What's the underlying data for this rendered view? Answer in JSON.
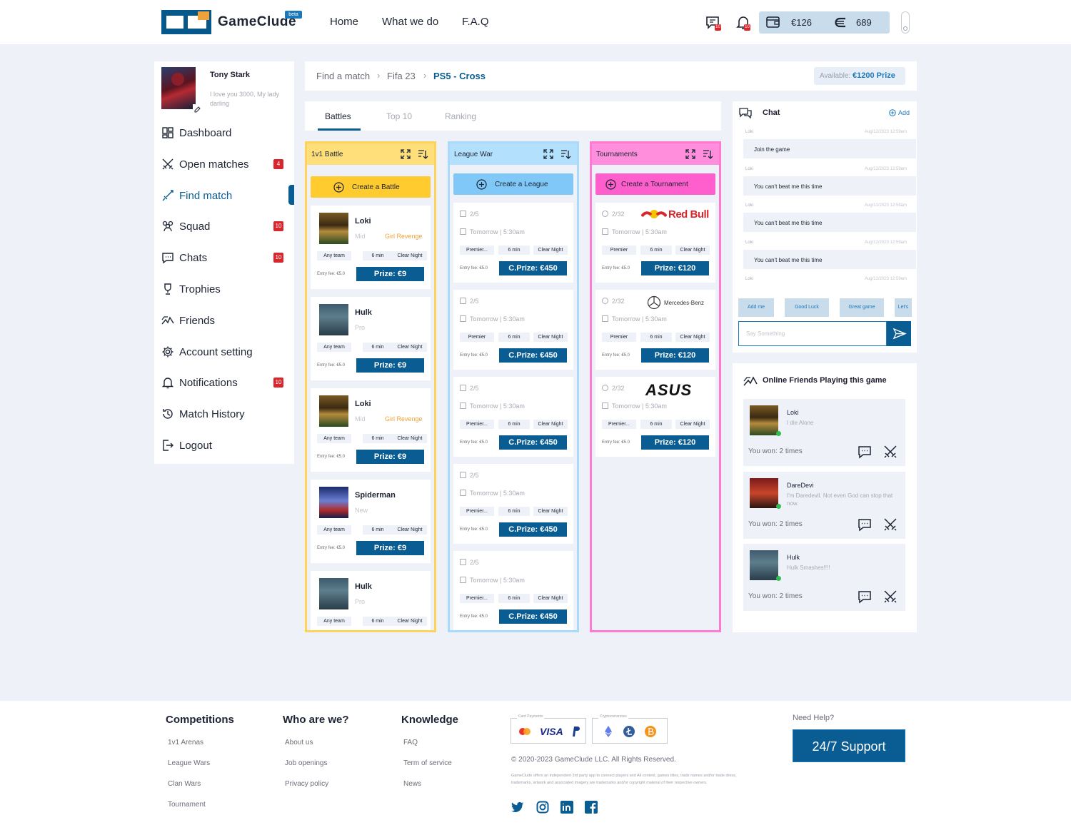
{
  "header": {
    "brand": "GameClude",
    "beta": "beta",
    "nav": [
      "Home",
      "What we do",
      "F.A.Q"
    ],
    "chat_badge": "10",
    "notif_badge": "10",
    "balance": "€126",
    "coins": "689"
  },
  "profile": {
    "name": "Tony Stark",
    "bio": "I love you 3000, My lady darling"
  },
  "sidebar": {
    "items": [
      {
        "label": "Dashboard",
        "icon": "dashboard-icon"
      },
      {
        "label": "Open matches",
        "icon": "swords-icon",
        "badge": "4"
      },
      {
        "label": "Find match",
        "icon": "sword-icon",
        "active": true
      },
      {
        "label": "Squad",
        "icon": "squad-icon",
        "badge": "10"
      },
      {
        "label": "Chats",
        "icon": "chat-icon",
        "badge": "10"
      },
      {
        "label": "Trophies",
        "icon": "trophy-icon"
      },
      {
        "label": "Friends",
        "icon": "friends-icon"
      },
      {
        "label": "Account setting",
        "icon": "gear-icon"
      },
      {
        "label": "Notifications",
        "icon": "bell-icon",
        "badge": "10"
      },
      {
        "label": "Match History",
        "icon": "history-icon"
      },
      {
        "label": "Logout",
        "icon": "logout-icon"
      }
    ]
  },
  "breadcrumb": {
    "items": [
      "Find a match",
      "Fifa 23",
      "PS5 - Cross"
    ],
    "available_label": "Available:",
    "available_value": "€1200 Prize"
  },
  "tabs": [
    "Battles",
    "Top 10",
    "Ranking"
  ],
  "columns": {
    "battle": {
      "title": "1v1 Battle",
      "button": "Create a Battle",
      "color": "#ffdf7a",
      "border": "#ffd25c",
      "btn": "#ffcb2f",
      "cards": [
        {
          "name": "Loki",
          "rank": "Mid",
          "badge": "Girl Revenge",
          "chips": [
            "Any team",
            "6 min",
            "Clear Night"
          ],
          "entry": "Entry fee: €5.0",
          "prize": "Prize: €9"
        },
        {
          "name": "Hulk",
          "rank": "Pro",
          "badge": "",
          "chips": [
            "Any team",
            "6 min",
            "Clear Night"
          ],
          "entry": "Entry fee: €5.0",
          "prize": "Prize: €9"
        },
        {
          "name": "Loki",
          "rank": "Mid",
          "badge": "Girl Revenge",
          "chips": [
            "Any team",
            "6 min",
            "Clear Night"
          ],
          "entry": "Entry fee: €5.0",
          "prize": "Prize: €9"
        },
        {
          "name": "Spiderman",
          "rank": "New",
          "badge": "",
          "chips": [
            "Any team",
            "6 min",
            "Clear Night"
          ],
          "entry": "Entry fee: €5.0",
          "prize": "Prize: €9"
        },
        {
          "name": "Hulk",
          "rank": "Pro",
          "badge": "",
          "chips": [
            "Any team",
            "6 min",
            "Clear Night"
          ],
          "entry": "",
          "prize": ""
        }
      ]
    },
    "league": {
      "title": "League War",
      "button": "Create a League",
      "cards": [
        {
          "slots": "2/5",
          "when": "Tomorrow | 5:30am",
          "chips": [
            "Premier...",
            "6 min",
            "Clear Night"
          ],
          "entry": "Entry fee: €5.0",
          "prize": "C.Prize: €450"
        },
        {
          "slots": "2/5",
          "when": "Tomorrow | 5:30am",
          "chips": [
            "Premier",
            "6 min",
            "Clear Night"
          ],
          "entry": "Entry fee: €5.0",
          "prize": "C.Prize: €450"
        },
        {
          "slots": "2/5",
          "when": "Tomorrow | 5:30am",
          "chips": [
            "Premier...",
            "6 min",
            "Clear Night"
          ],
          "entry": "Entry fee: €5.0",
          "prize": "C.Prize: €450"
        },
        {
          "slots": "2/5",
          "when": "Tomorrow | 5:30am",
          "chips": [
            "Premier...",
            "6 min",
            "Clear Night"
          ],
          "entry": "Entry fee: €5.0",
          "prize": "C.Prize: €450"
        },
        {
          "slots": "2/5",
          "when": "Tomorrow | 5:30am",
          "chips": [
            "Premier...",
            "6 min",
            "Clear Night"
          ],
          "entry": "Entry fee: €5.0",
          "prize": "C.Prize: €450"
        }
      ]
    },
    "tournament": {
      "title": "Tournaments",
      "button": "Create a Tournament",
      "cards": [
        {
          "slots": "2/32",
          "sponsor": "Red Bull",
          "when": "Tomorrow | 5:30am",
          "chips": [
            "Premier",
            "6 min",
            "Clear Night"
          ],
          "entry": "Entry fee: €5.0",
          "prize": "Prize: €120"
        },
        {
          "slots": "2/32",
          "sponsor": "Mercedes-Benz",
          "when": "Tomorrow | 5:30am",
          "chips": [
            "Premier",
            "6 min",
            "Clear Night"
          ],
          "entry": "Entry fee: €5.0",
          "prize": "Prize: €120"
        },
        {
          "slots": "2/32",
          "sponsor": "ASUS",
          "when": "Tomorrow | 5:30am",
          "chips": [
            "Premier...",
            "6 min",
            "Clear Night"
          ],
          "entry": "Entry fee: €5.0",
          "prize": "Prize: €120"
        }
      ]
    }
  },
  "chat": {
    "title": "Chat",
    "add": "Add",
    "messages": [
      {
        "who": "Loki",
        "ts": "Aug/12/2023 12:59am",
        "text": "Join the game"
      },
      {
        "who": "Loki",
        "ts": "Aug/12/2023 12:59am",
        "text": "You can't beat me this time"
      },
      {
        "who": "Loki",
        "ts": "Aug/12/2023 12:59am",
        "text": "You can't beat me this time"
      },
      {
        "who": "Loki",
        "ts": "Aug/12/2023 12:59am",
        "text": "You can't beat me this time"
      },
      {
        "who": "Loki",
        "ts": "Aug/12/2023 12:59am",
        "text": ""
      }
    ],
    "quick": [
      "Add me",
      "Good Luck",
      "Great game",
      "Let's"
    ],
    "placeholder": "Say Something"
  },
  "friends": {
    "title": "Online Friends Playing this game",
    "list": [
      {
        "name": "Loki",
        "status": "I die Alone",
        "won": "You won: 2 times"
      },
      {
        "name": "DareDevi",
        "status": "I'm Daredevil. Not even God can stop that now.",
        "won": "You won: 2 times"
      },
      {
        "name": "Hulk",
        "status": "Hulk Smashes!!!!",
        "won": "You won: 2 times"
      }
    ]
  },
  "footer": {
    "cols": [
      {
        "title": "Competitions",
        "links": [
          "1v1 Arenas",
          "League Wars",
          "Clan Wars",
          "Tournament"
        ]
      },
      {
        "title": "Who are we?",
        "links": [
          "About us",
          "Job openings",
          "Privacy policy"
        ]
      },
      {
        "title": "Knowledge",
        "links": [
          "FAQ",
          "Term of service",
          "News"
        ]
      }
    ],
    "card_payments": "Card Payments",
    "crypto": "Cryptocurrencies",
    "visa": "VISA",
    "copyright": "© 2020-2023 GameClude LLC. All Rights Reserved.",
    "disclaimer": "GameClude offers an independent 3rd party app to connect players and All content, games titles, trade names and/or trade dress, trademarks, artwork and associated imagery are trademarks and/or copyright material of their respective owners.",
    "need_help": "Need Help?",
    "support": "24/7 Support"
  }
}
